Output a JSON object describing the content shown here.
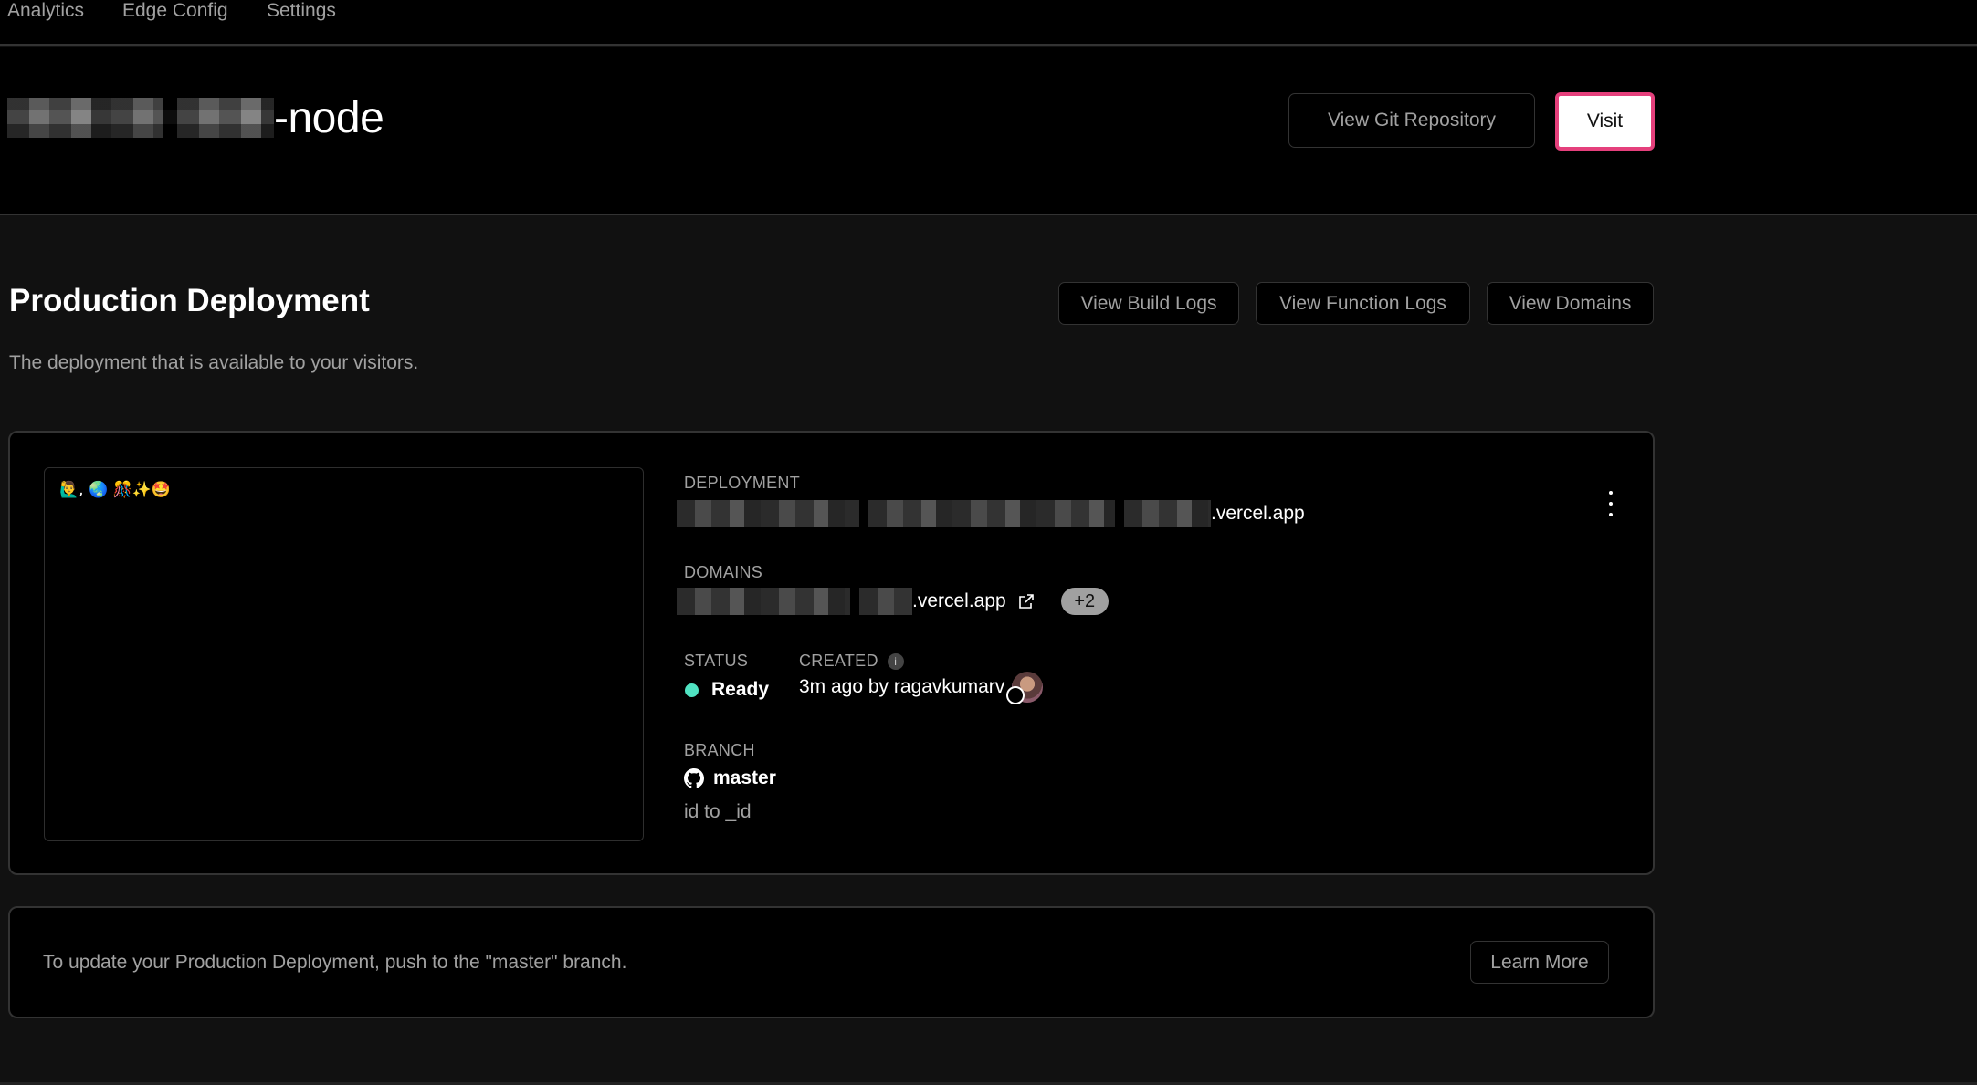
{
  "nav": {
    "items": [
      {
        "label": "Analytics"
      },
      {
        "label": "Edge Config"
      },
      {
        "label": "Settings"
      }
    ]
  },
  "header": {
    "project_suffix": "-node",
    "view_git_label": "View Git Repository",
    "visit_label": "Visit",
    "visit_border_color": "#e5407c"
  },
  "production": {
    "title": "Production Deployment",
    "description": "The deployment that is available to your visitors.",
    "buttons": {
      "build_logs": "View Build Logs",
      "function_logs": "View Function Logs",
      "domains": "View Domains"
    },
    "preview_text": "🙋‍♂️, 🌏 🎊✨🤩",
    "deployment": {
      "label": "DEPLOYMENT",
      "url_suffix": ".vercel.app"
    },
    "domains": {
      "label": "DOMAINS",
      "url_suffix": ".vercel.app",
      "extra_count": "+2"
    },
    "status": {
      "label": "STATUS",
      "value": "Ready",
      "color": "#50e3c2"
    },
    "created": {
      "label": "CREATED",
      "value": "3m ago by ragavkumarv"
    },
    "branch": {
      "label": "BRANCH",
      "name": "master",
      "commit_message": "id to _id"
    }
  },
  "note": {
    "text": "To update your Production Deployment, push to the \"master\" branch.",
    "learn_more_label": "Learn More"
  }
}
